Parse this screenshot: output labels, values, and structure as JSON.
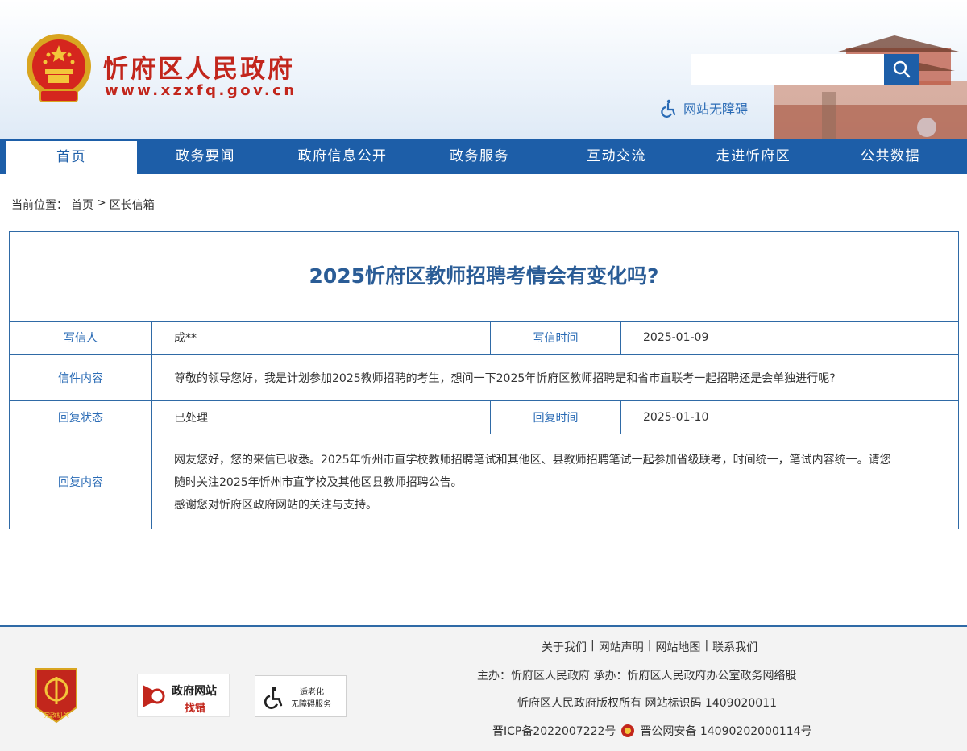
{
  "header": {
    "site_title": "忻府区人民政府",
    "site_url": "www.xzxfq.gov.cn",
    "search_placeholder": "",
    "accessibility_label": "网站无障碍",
    "extra_tool_1": "",
    "extra_tool_2": ""
  },
  "nav": {
    "items": [
      {
        "label": "首页"
      },
      {
        "label": "政务要闻"
      },
      {
        "label": "政府信息公开"
      },
      {
        "label": "政务服务"
      },
      {
        "label": "互动交流"
      },
      {
        "label": "走进忻府区"
      },
      {
        "label": "公共数据"
      }
    ]
  },
  "breadcrumb": {
    "prefix": "当前位置：",
    "home": "首页",
    "sep": ">",
    "current": "区长信箱"
  },
  "letter": {
    "title": "2025忻府区教师招聘考情会有变化吗?",
    "writer_label": "写信人",
    "writer": "成**",
    "write_time_label": "写信时间",
    "write_time": "2025-01-09",
    "content_label": "信件内容",
    "content": "尊敬的领导您好，我是计划参加2025教师招聘的考生，想问一下2025年忻府区教师招聘是和省市直联考一起招聘还是会单独进行呢?",
    "status_label": "回复状态",
    "status": "已处理",
    "reply_time_label": "回复时间",
    "reply_time": "2025-01-10",
    "reply_label": "回复内容",
    "reply_line1": "网友您好，您的来信已收悉。2025年忻州市直学校教师招聘笔试和其他区、县教师招聘笔试一起参加省级联考，时间统一，笔试内容统一。请您",
    "reply_line2": "随时关注2025年忻州市直学校及其他区县教师招聘公告。",
    "reply_line3": "感谢您对忻府区政府网站的关注与支持。"
  },
  "footer": {
    "links": [
      "关于我们",
      "网站声明",
      "网站地图",
      "联系我们"
    ],
    "link_sep": "|",
    "host_line": "主办：忻府区人民政府   承办：忻府区人民政府办公室政务网络股",
    "copyright_line": "忻府区人民政府版权所有  网站标识码 1409020011",
    "icp": "晋ICP备2022007222号",
    "police": "晋公网安备 14090202000114号",
    "badge_dj": "党政机关",
    "badge_zc_1": "政府网站",
    "badge_zc_2": "找错",
    "badge_ac_1": "适老化",
    "badge_ac_2": "无障碍服务"
  },
  "colors": {
    "nav_blue": "#1d5ea8",
    "title_red": "#c2261c",
    "table_border": "#2f6aa6",
    "label_blue": "#2a6bb5"
  }
}
